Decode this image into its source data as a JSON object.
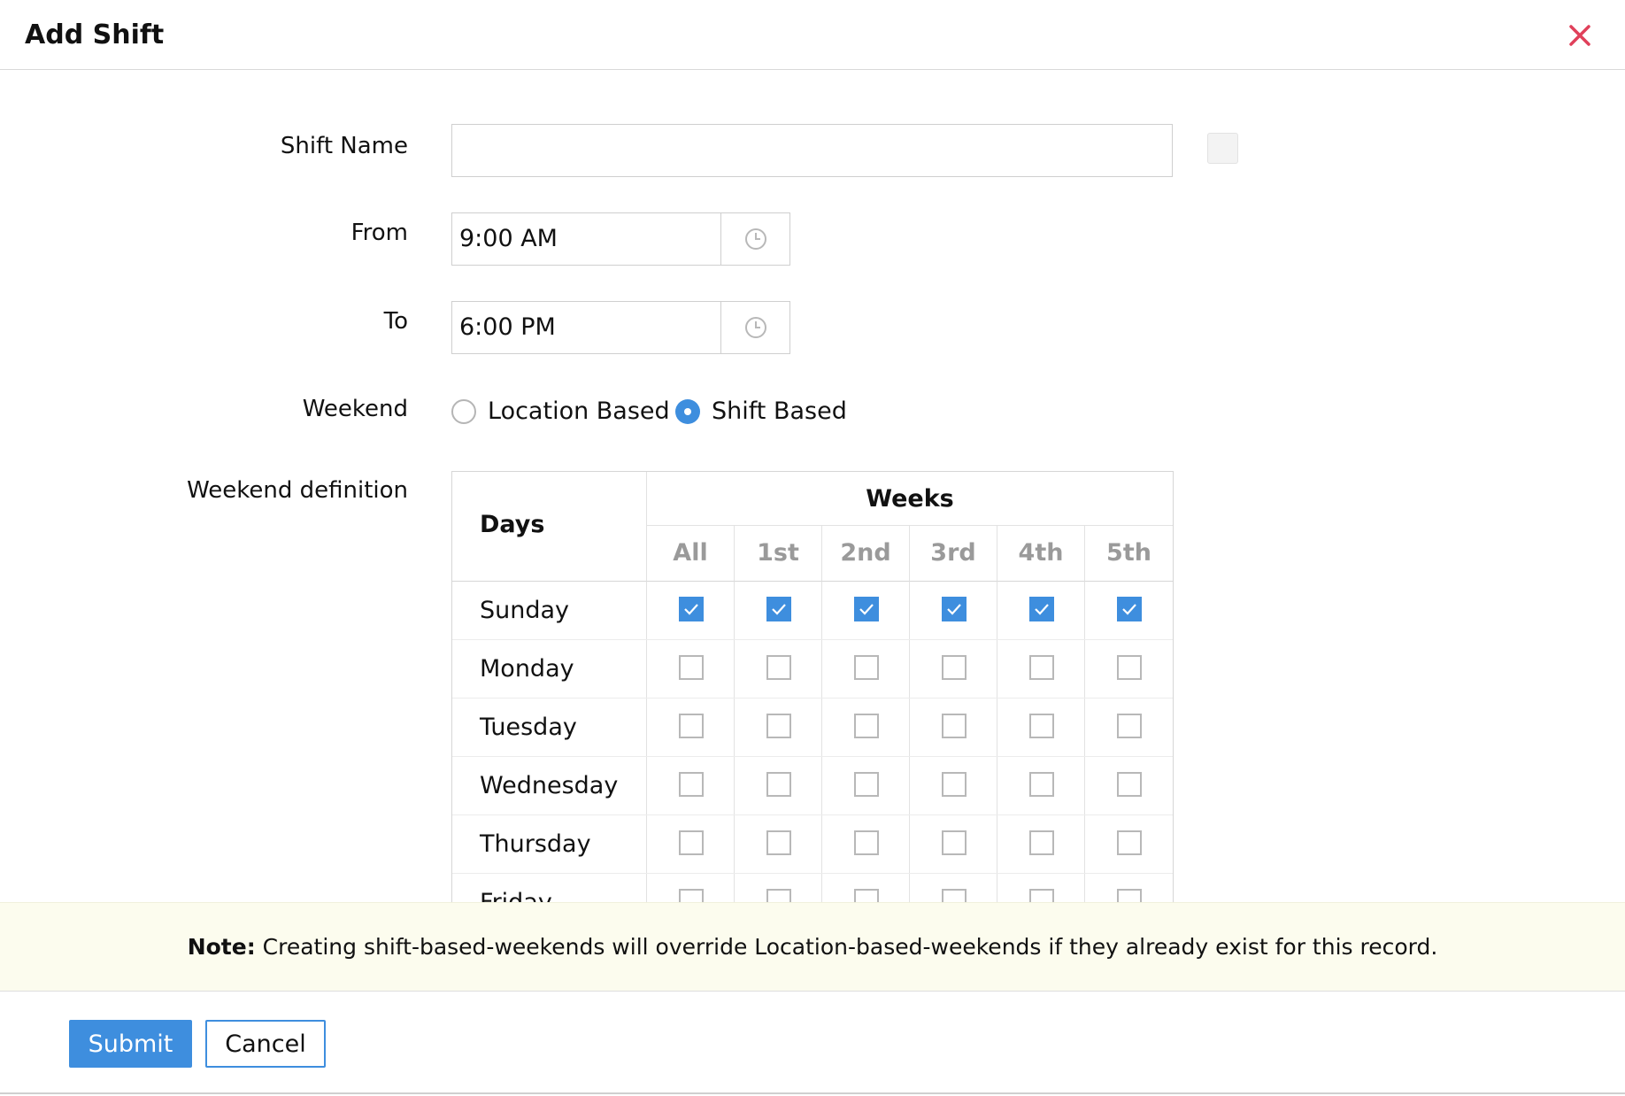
{
  "dialog": {
    "title": "Add Shift",
    "close_icon": "close-icon",
    "accent_color": "#3e8ede",
    "close_color": "#e0405a"
  },
  "form": {
    "shift_name": {
      "label": "Shift Name",
      "value": "",
      "placeholder": ""
    },
    "from": {
      "label": "From",
      "value": "9:00 AM",
      "icon": "clock-icon"
    },
    "to": {
      "label": "To",
      "value": "6:00 PM",
      "icon": "clock-icon"
    },
    "weekend": {
      "label": "Weekend",
      "options": [
        {
          "label": "Location Based",
          "selected": false
        },
        {
          "label": "Shift Based",
          "selected": true
        }
      ]
    },
    "weekend_definition": {
      "label": "Weekend definition",
      "days_header": "Days",
      "weeks_header": "Weeks",
      "week_columns": [
        "All",
        "1st",
        "2nd",
        "3rd",
        "4th",
        "5th"
      ],
      "rows": [
        {
          "day": "Sunday",
          "checked": [
            true,
            true,
            true,
            true,
            true,
            true
          ]
        },
        {
          "day": "Monday",
          "checked": [
            false,
            false,
            false,
            false,
            false,
            false
          ]
        },
        {
          "day": "Tuesday",
          "checked": [
            false,
            false,
            false,
            false,
            false,
            false
          ]
        },
        {
          "day": "Wednesday",
          "checked": [
            false,
            false,
            false,
            false,
            false,
            false
          ]
        },
        {
          "day": "Thursday",
          "checked": [
            false,
            false,
            false,
            false,
            false,
            false
          ]
        },
        {
          "day": "Friday",
          "checked": [
            false,
            false,
            false,
            false,
            false,
            false
          ]
        }
      ]
    }
  },
  "note": {
    "prefix": "Note:",
    "text": " Creating shift-based-weekends will override Location-based-weekends if they already exist for this record."
  },
  "footer": {
    "submit_label": "Submit",
    "cancel_label": "Cancel"
  }
}
